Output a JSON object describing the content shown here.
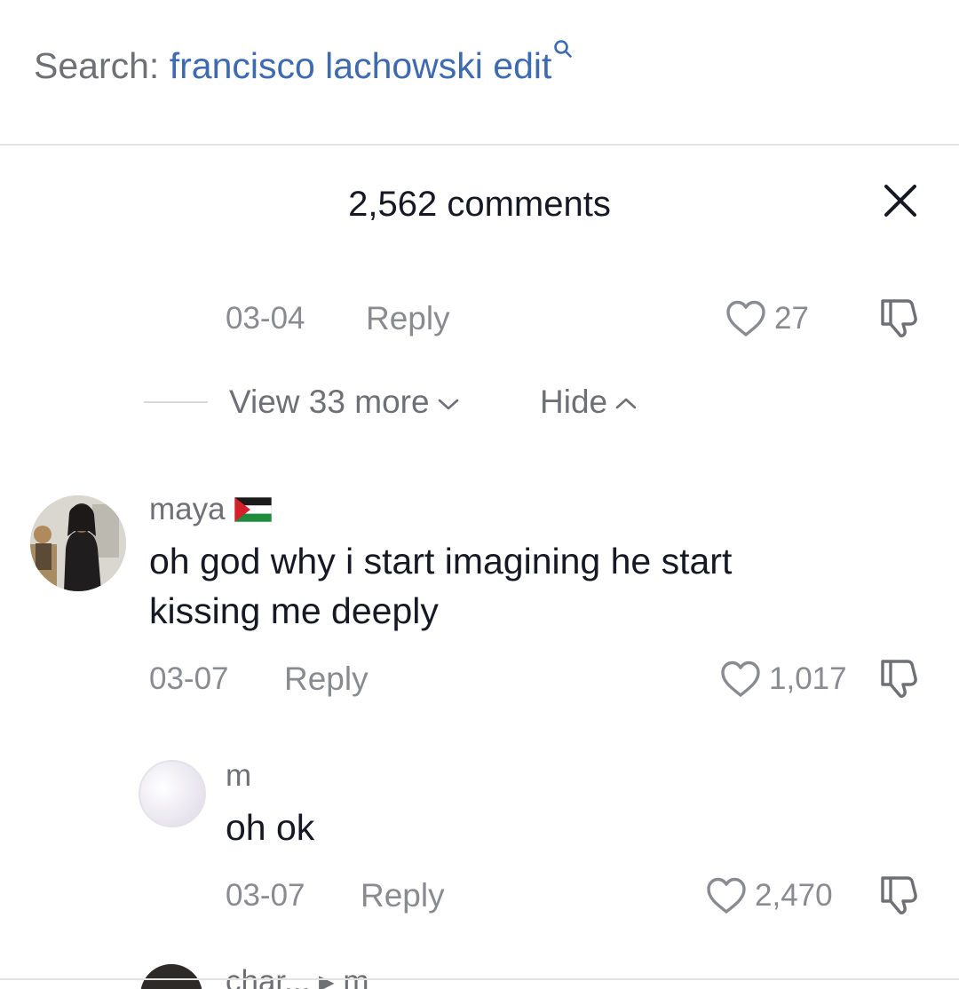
{
  "search": {
    "prefix": "Search:",
    "query": "francisco lachowski edit"
  },
  "header": {
    "title": "2,562 comments"
  },
  "prev_comment": {
    "date": "03-04",
    "reply_label": "Reply",
    "likes": "27"
  },
  "thread_controls": {
    "view_more": "View 33 more",
    "hide": "Hide"
  },
  "comments": [
    {
      "username": "maya",
      "text_line1": "oh god why i start imagining he start",
      "text_line2": "kissing me deeply",
      "date": "03-07",
      "reply_label": "Reply",
      "likes": "1,017"
    },
    {
      "username": "m",
      "text": "oh ok",
      "date": "03-07",
      "reply_label": "Reply",
      "likes": "2,470"
    }
  ],
  "partial_next": {
    "username": "char... ▸ m"
  },
  "colors": {
    "accent_link": "#3d6ab1",
    "secondary_text": "#8a8b91",
    "primary_text": "#161823"
  }
}
